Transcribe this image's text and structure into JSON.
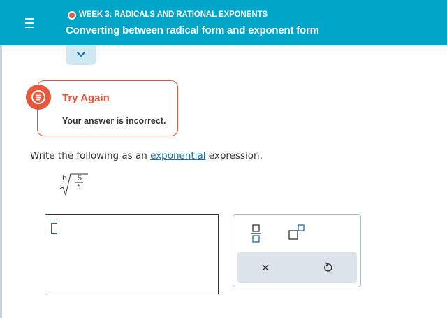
{
  "header": {
    "week_label": "WEEK 3: RADICALS AND RATIONAL EXPONENTS",
    "topic_title": "Converting between radical form and exponent form",
    "accent_color": "#00a5c8",
    "status_color": "#e8573c"
  },
  "feedback": {
    "title": "Try Again",
    "message": "Your answer is incorrect.",
    "color": "#e8573c"
  },
  "question": {
    "prefix": "Write the following as an ",
    "link_text": "exponential",
    "suffix": " expression."
  },
  "expression": {
    "index": "6",
    "numerator": "5",
    "base": "t"
  },
  "answer": {
    "value": ""
  },
  "palette": {
    "buttons": [
      "fraction-icon",
      "exponent-icon",
      "clear-icon",
      "undo-icon"
    ]
  }
}
